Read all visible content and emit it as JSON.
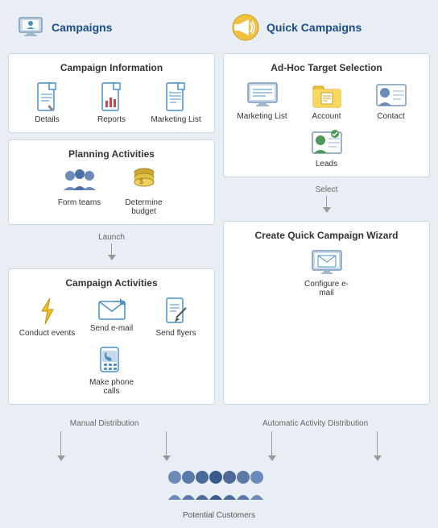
{
  "campaigns": {
    "title": "Campaigns",
    "sections": {
      "campaign_info": {
        "title": "Campaign Information",
        "items": [
          {
            "label": "Details",
            "icon": "doc-icon"
          },
          {
            "label": "Reports",
            "icon": "reports-icon"
          },
          {
            "label": "Marketing List",
            "icon": "list-icon"
          }
        ]
      },
      "planning": {
        "title": "Planning Activities",
        "items": [
          {
            "label": "Form teams",
            "icon": "teams-icon"
          },
          {
            "label": "Determine budget",
            "icon": "budget-icon"
          }
        ]
      },
      "launch_arrow": "Launch",
      "campaign_activities": {
        "title": "Campaign Activities",
        "items": [
          {
            "label": "Conduct events",
            "icon": "events-icon"
          },
          {
            "label": "Send e-mail",
            "icon": "email-icon"
          },
          {
            "label": "Send flyers",
            "icon": "flyers-icon"
          },
          {
            "label": "Make phone calls",
            "icon": "phone-icon"
          }
        ]
      }
    }
  },
  "quick_campaigns": {
    "title": "Quick Campaigns",
    "sections": {
      "adhoc": {
        "title": "Ad-Hoc Target Selection",
        "items": [
          {
            "label": "Marketing List",
            "icon": "mktlist-icon"
          },
          {
            "label": "Account",
            "icon": "account-icon"
          },
          {
            "label": "Contact",
            "icon": "contact-icon"
          },
          {
            "label": "Leads",
            "icon": "leads-icon"
          }
        ]
      },
      "select_arrow": "Select",
      "wizard": {
        "title": "Create Quick Campaign Wizard",
        "items": [
          {
            "label": "Configure e-mail",
            "icon": "configure-email-icon"
          }
        ]
      }
    }
  },
  "bottom": {
    "manual_label": "Manual Distribution",
    "automatic_label": "Automatic Activity Distribution",
    "customers_label": "Potential Customers"
  }
}
